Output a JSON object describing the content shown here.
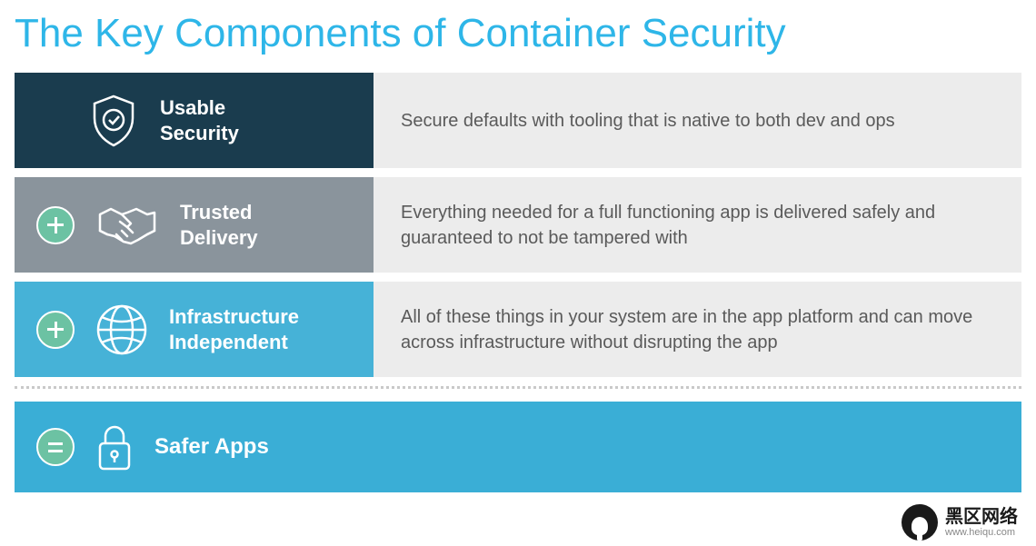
{
  "title": "The Key Components of Container Security",
  "rows": [
    {
      "label": "Usable\nSecurity",
      "desc": "Secure defaults with tooling that is native to both dev and ops",
      "color": "#1a3c4e",
      "icon": "shield-check"
    },
    {
      "label": "Trusted\nDelivery",
      "desc": "Everything needed for a full functioning app is delivered safely and guaranteed to not be tampered with",
      "color": "#8a949c",
      "icon": "handshake"
    },
    {
      "label": "Infrastructure\nIndependent",
      "desc": "All of these things in your system are in the app platform and can move across infrastructure without disrupting the app",
      "color": "#46b2d7",
      "icon": "globe"
    }
  ],
  "result": {
    "label": "Safer Apps",
    "color": "#3aaed6",
    "icon": "lock"
  },
  "watermark": {
    "title": "黑区网络",
    "url": "www.heiqu.com"
  }
}
